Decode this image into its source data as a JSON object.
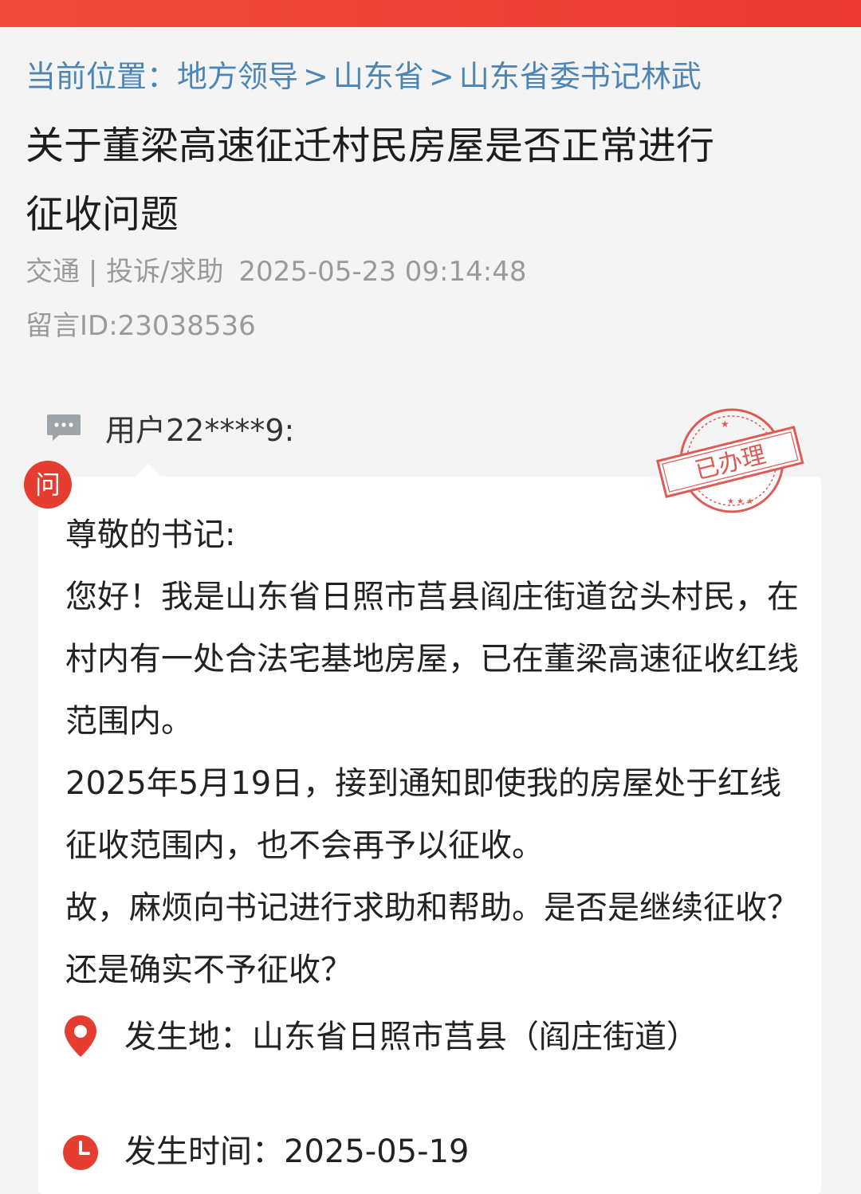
{
  "colors": {
    "brand_red": "#ee3a33",
    "link_blue": "#4d86b5",
    "meta_gray": "#9a9a9a",
    "stamp_red": "#d9403a"
  },
  "breadcrumb": {
    "prefix": "当前位置：",
    "items": [
      "地方领导",
      "山东省",
      "山东省委书记林武"
    ],
    "separator": ">"
  },
  "post": {
    "title": "关于董梁高速征迁村民房屋是否正常进行征收问题",
    "category": "交通",
    "type": "投诉/求助",
    "datetime": "2025-05-23 09:14:48",
    "message_id": "留言ID:23038536"
  },
  "author": {
    "icon": "chat-bubble-icon",
    "name": "用户22****9:"
  },
  "question": {
    "badge": "问",
    "stamp": "已办理",
    "paragraphs": [
      "尊敬的书记:",
      "您好！我是山东省日照市莒县阎庄街道岔头村民，在村内有一处合法宅基地房屋，已在董梁高速征收红线范围内。",
      "2025年5月19日，接到通知即使我的房屋处于红线征收范围内，也不会再予以征收。",
      "故，麻烦向书记进行求助和帮助。是否是继续征收？还是确实不予征收？"
    ]
  },
  "details": {
    "location_label": "发生地：",
    "location_value": "山东省日照市莒县（阎庄街道）",
    "location_icon": "map-pin-icon",
    "time_label": "发生时间：",
    "time_value": "2025-05-19",
    "time_icon": "clock-icon"
  }
}
